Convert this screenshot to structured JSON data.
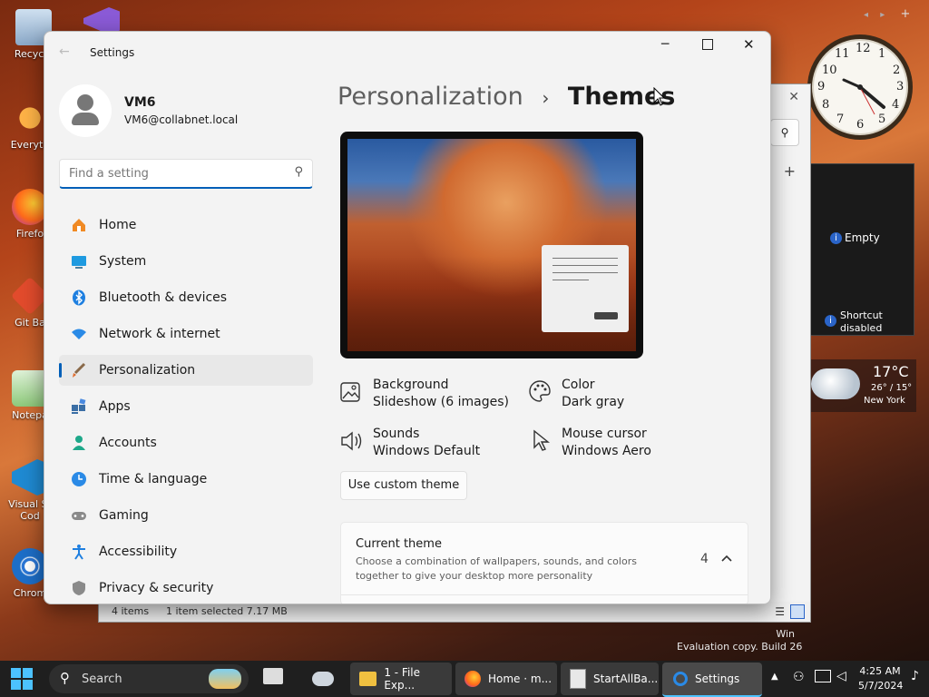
{
  "desktop": {
    "icons": [
      {
        "label": "Recycle",
        "icon": "recycle-bin-icon"
      },
      {
        "label": "Everyth",
        "icon": "everything-icon"
      },
      {
        "label": "Firefo",
        "icon": "firefox-icon"
      },
      {
        "label": "Git Ba",
        "icon": "git-bash-icon"
      },
      {
        "label": "Notepa",
        "icon": "notepad-icon"
      },
      {
        "label": "Visual St Cod",
        "icon": "vscode-icon"
      },
      {
        "label": "Chrom",
        "icon": "chrome-icon"
      }
    ],
    "watermark_line1": "Win",
    "watermark_line2": "Evaluation copy. Build 26"
  },
  "gadgets": {
    "clock": {
      "numerals": [
        "12",
        "1",
        "2",
        "3",
        "4",
        "5",
        "6",
        "7",
        "8",
        "9",
        "10",
        "11"
      ],
      "time": "4:25"
    },
    "slideshow": {
      "empty_label": "Empty",
      "shortcut_label_1": "Shortcut",
      "shortcut_label_2": "disabled"
    },
    "weather": {
      "temp": "17°C",
      "range": "26° / 15°",
      "city": "New York"
    }
  },
  "explorer": {
    "status_items": "4 items",
    "status_selected": "1 item selected  7.17 MB"
  },
  "settings": {
    "title": "Settings",
    "user": {
      "name": "VM6",
      "email": "VM6@collabnet.local"
    },
    "search_placeholder": "Find a setting",
    "nav": [
      {
        "label": "Home",
        "icon": "home-icon"
      },
      {
        "label": "System",
        "icon": "system-icon"
      },
      {
        "label": "Bluetooth & devices",
        "icon": "bluetooth-icon"
      },
      {
        "label": "Network & internet",
        "icon": "wifi-icon"
      },
      {
        "label": "Personalization",
        "icon": "brush-icon",
        "selected": true
      },
      {
        "label": "Apps",
        "icon": "apps-icon"
      },
      {
        "label": "Accounts",
        "icon": "account-icon"
      },
      {
        "label": "Time & language",
        "icon": "globe-clock-icon"
      },
      {
        "label": "Gaming",
        "icon": "gamepad-icon"
      },
      {
        "label": "Accessibility",
        "icon": "accessibility-icon"
      },
      {
        "label": "Privacy & security",
        "icon": "shield-icon"
      }
    ],
    "breadcrumb": {
      "parent": "Personalization",
      "separator": "›",
      "current": "Themes"
    },
    "properties": [
      {
        "title": "Background",
        "value": "Slideshow (6 images)",
        "icon": "image-icon"
      },
      {
        "title": "Color",
        "value": "Dark gray",
        "icon": "palette-icon"
      },
      {
        "title": "Sounds",
        "value": "Windows Default",
        "icon": "speaker-icon"
      },
      {
        "title": "Mouse cursor",
        "value": "Windows Aero",
        "icon": "cursor-icon"
      }
    ],
    "custom_theme_button": "Use custom theme",
    "current_theme": {
      "title": "Current theme",
      "description": "Choose a combination of wallpapers, sounds, and colors together to give your desktop more personality",
      "count": "4"
    }
  },
  "taskbar": {
    "search_label": "Search",
    "buttons": [
      {
        "label": "1 - File Exp...",
        "icon": "folder-icon"
      },
      {
        "label": "Home · m...",
        "icon": "firefox-icon"
      },
      {
        "label": "StartAllBa...",
        "icon": "document-icon"
      },
      {
        "label": "Settings",
        "icon": "gear-icon",
        "active": true
      }
    ],
    "time": "4:25 AM",
    "date": "5/7/2024"
  }
}
